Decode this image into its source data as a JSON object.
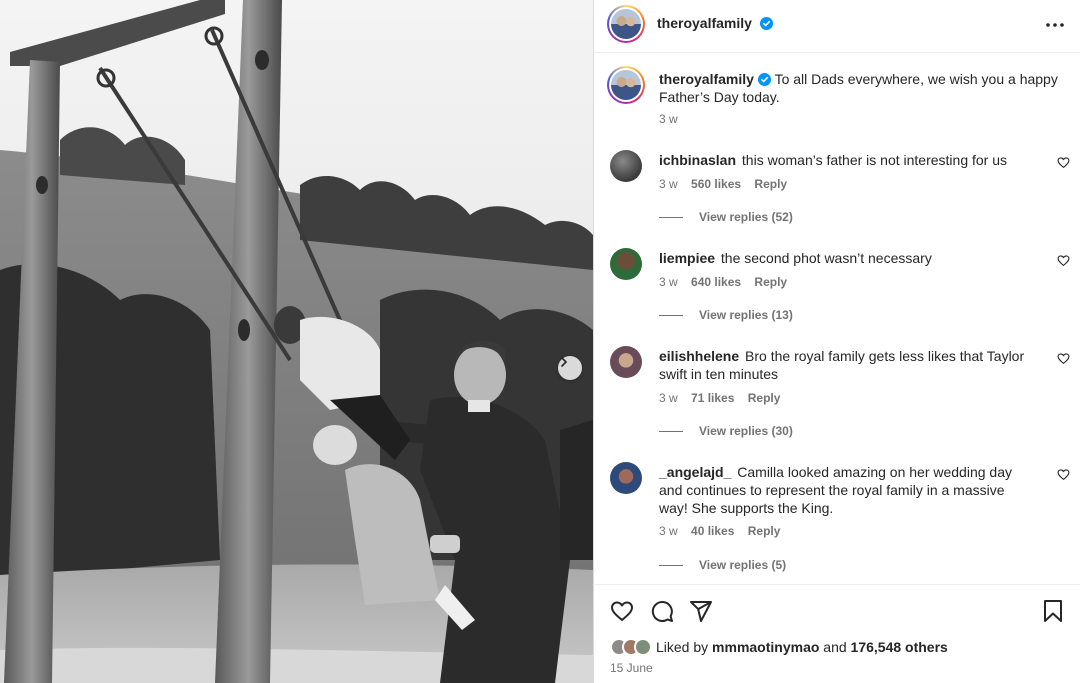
{
  "post": {
    "username": "theroyalfamily",
    "caption": "To all Dads everywhere, we wish you a happy Father’s Day today.",
    "caption_age": "3 w"
  },
  "comments": [
    {
      "username": "ichbinaslan",
      "text": "this woman’s father is not interesting for us",
      "age": "3 w",
      "likes": "560 likes",
      "reply": "Reply",
      "replies": "View replies (52)"
    },
    {
      "username": "liempiee",
      "text": "the second phot wasn’t necessary",
      "age": "3 w",
      "likes": "640 likes",
      "reply": "Reply",
      "replies": "View replies (13)"
    },
    {
      "username": "eilishhelene",
      "text": "Bro the royal family gets less likes that Taylor swift in ten minutes",
      "age": "3 w",
      "likes": "71 likes",
      "reply": "Reply",
      "replies": "View replies (30)"
    },
    {
      "username": "_angelajd_",
      "text": "Camilla looked amazing on her wedding day and continues to represent the royal family in a massive way! She supports the King.",
      "age": "3 w",
      "likes": "40 likes",
      "reply": "Reply",
      "replies": "View replies (5)"
    }
  ],
  "likes": {
    "prefix": "Liked by",
    "user": "mmmaotinymao",
    "middle": "and",
    "others": "176,548 others"
  },
  "date": "15 June",
  "icons": {
    "verified": "verified-badge-icon",
    "more": "more-options-icon",
    "like": "heart-icon",
    "comment": "comment-icon",
    "share": "share-icon",
    "save": "bookmark-icon",
    "next": "chevron-right-icon"
  },
  "colors": {
    "verified": "#0095f6",
    "text": "#262626",
    "muted": "#737373"
  }
}
